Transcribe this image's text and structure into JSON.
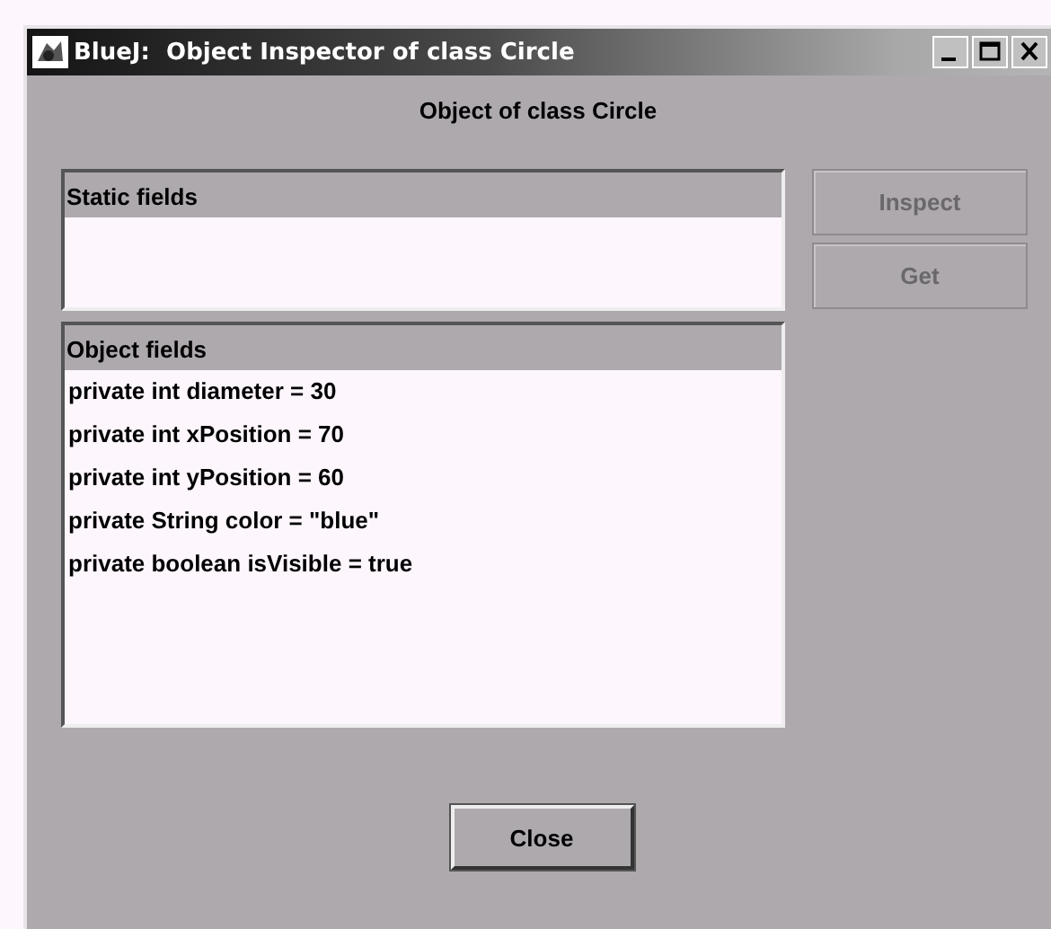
{
  "window": {
    "title": "BlueJ:  Object Inspector of class Circle"
  },
  "heading": "Object of class Circle",
  "static_fields": {
    "header": "Static fields"
  },
  "object_fields": {
    "header": "Object fields",
    "items": [
      {
        "text": "private int diameter = 30"
      },
      {
        "text": "private int xPosition = 70"
      },
      {
        "text": "private int yPosition = 60"
      },
      {
        "text": "private String color = \"blue\""
      },
      {
        "text": "private boolean isVisible = true"
      }
    ]
  },
  "side_buttons": [
    {
      "label": "Inspect",
      "disabled": true
    },
    {
      "label": "Get",
      "disabled": true
    }
  ],
  "close_button": {
    "label": "Close"
  }
}
